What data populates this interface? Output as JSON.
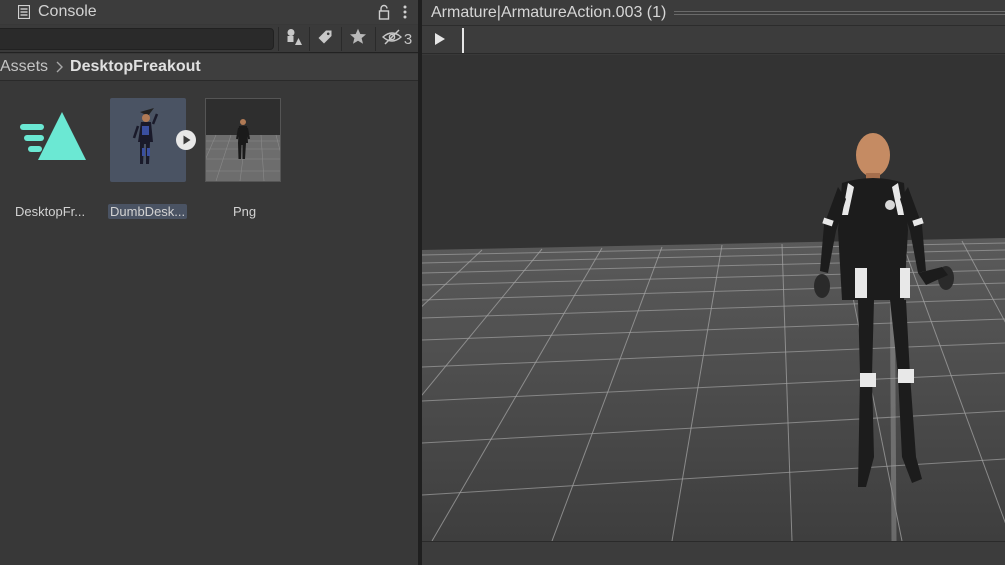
{
  "window": {
    "tab": {
      "label": "Console",
      "icon": "console-icon"
    },
    "lock_icon": "lock-icon",
    "menu_icon": "menu-dots-icon"
  },
  "toolbar": {
    "search": {
      "value": "",
      "placeholder": ""
    },
    "buttons": [
      {
        "name": "filter-by-type-button",
        "icon": "shapes-icon"
      },
      {
        "name": "filter-by-label-button",
        "icon": "tag-icon"
      },
      {
        "name": "favorites-button",
        "icon": "star-icon"
      }
    ],
    "hidden_packages": {
      "icon": "eye-slash-icon",
      "count": "3"
    }
  },
  "breadcrumb": {
    "root": "Assets",
    "separator_icon": "chevron-right-icon",
    "current": "DesktopFreakout"
  },
  "assets": [
    {
      "label": "DesktopFr...",
      "icon": "triangle-speed-logo-icon",
      "color": "#6be8d3",
      "selected": false
    },
    {
      "label": "DumbDesk...",
      "icon": "model-thumbnail",
      "selected": true,
      "has_play_badge": true
    },
    {
      "label": "Png",
      "icon": "image-thumbnail",
      "selected": false
    }
  ],
  "preview": {
    "title": "Armature|ArmatureAction.003 (1)",
    "play_icon": "play-icon"
  },
  "colors": {
    "panel_bg": "#383838",
    "selected_tile_bg": "#4a5363",
    "logo_accent": "#6be8d3"
  }
}
